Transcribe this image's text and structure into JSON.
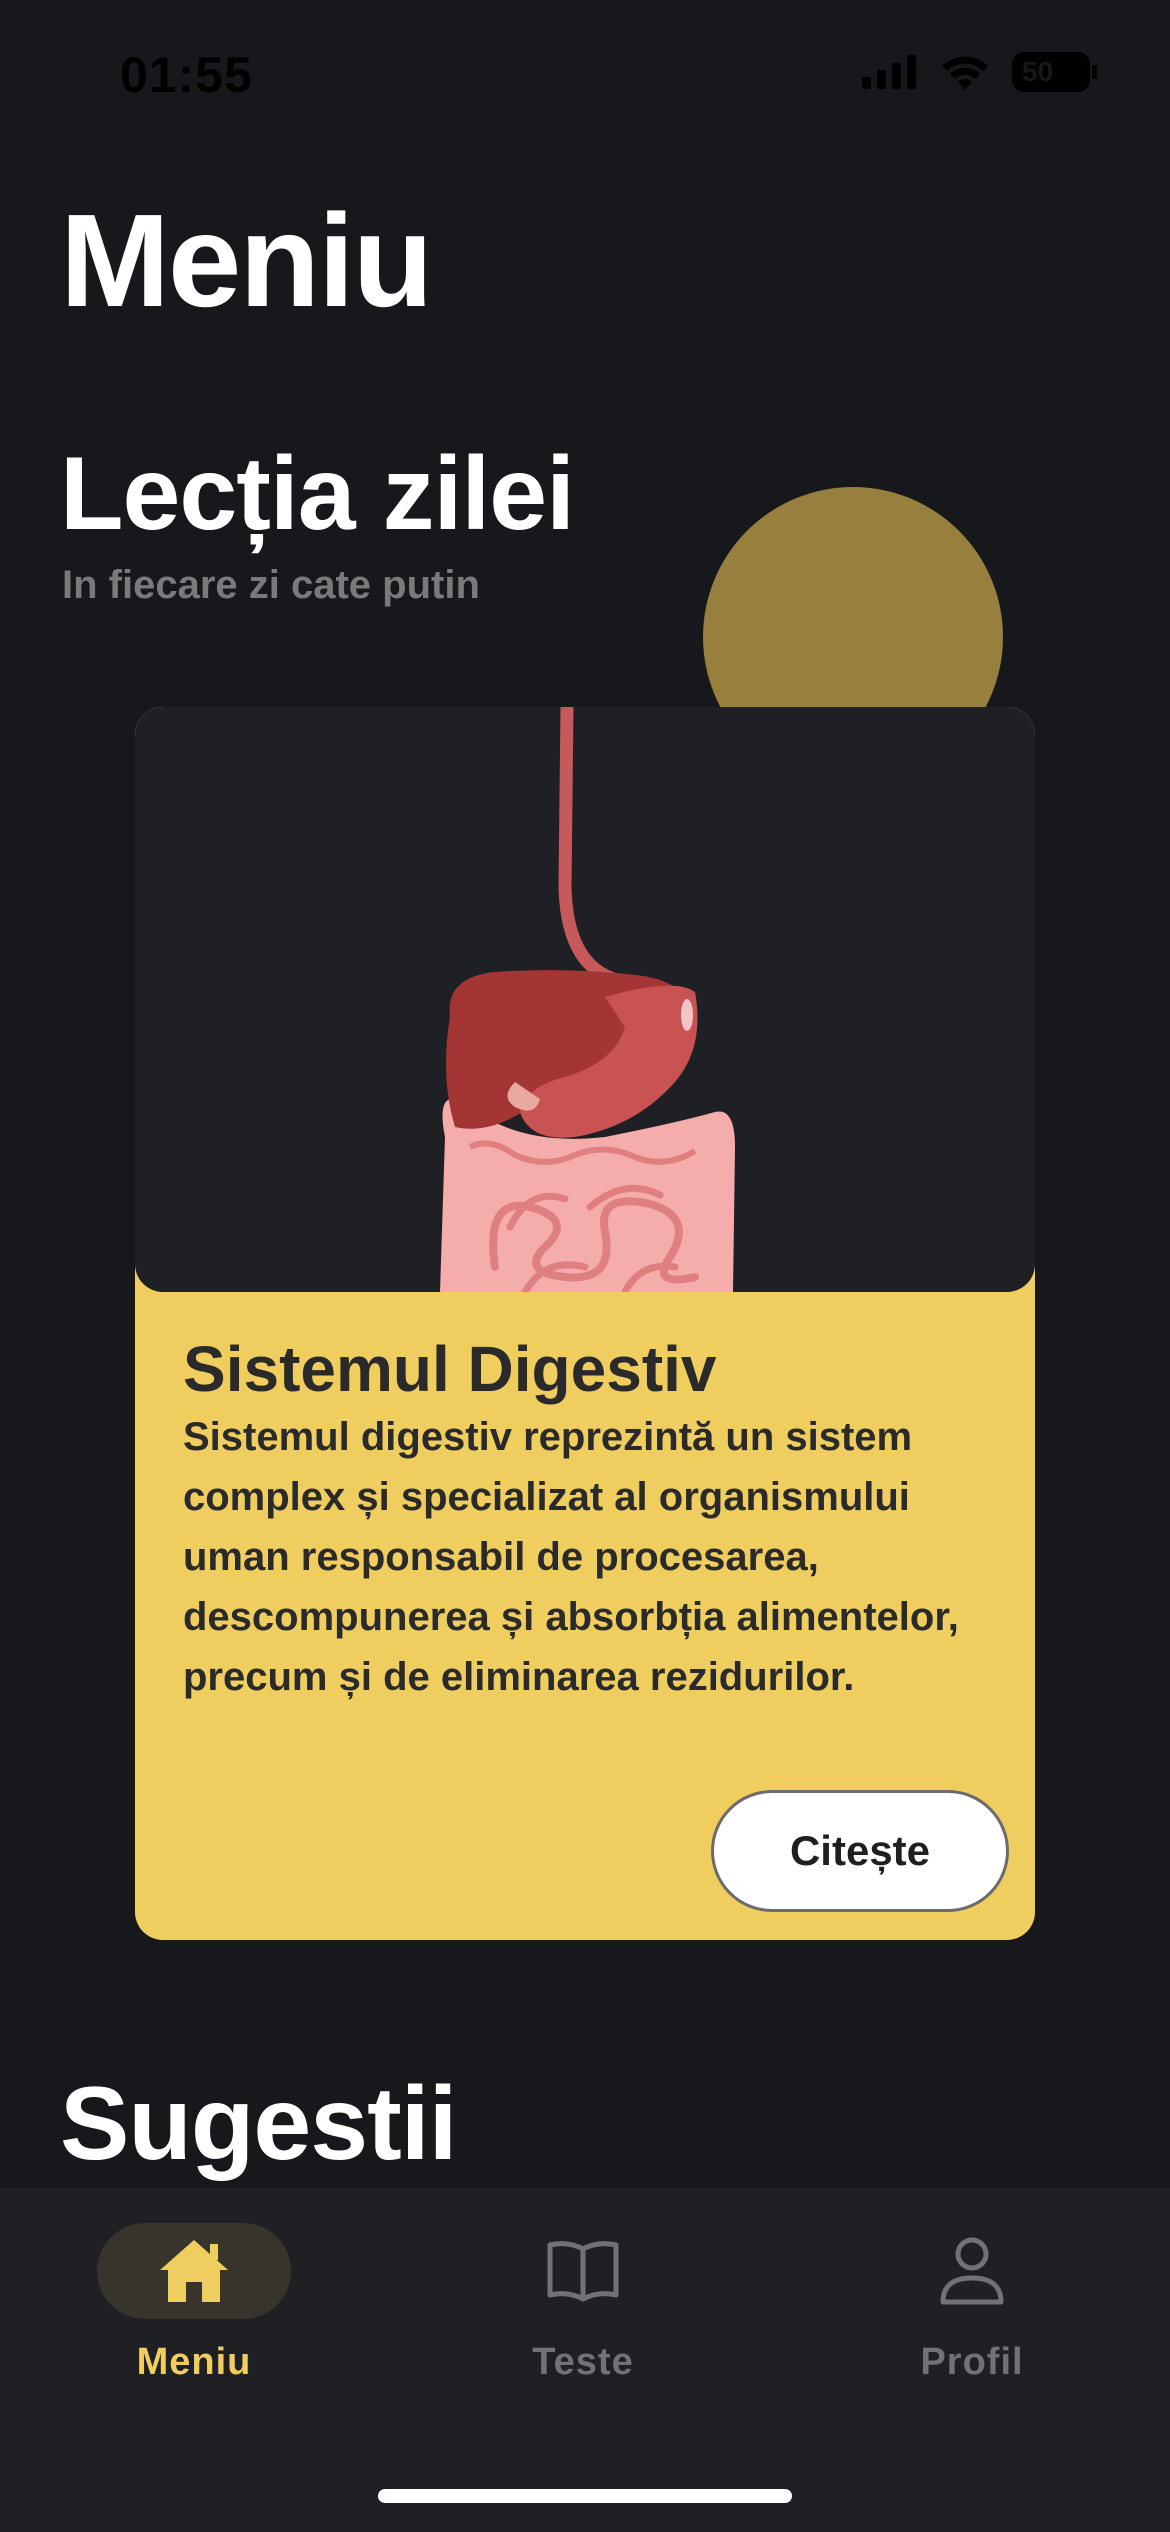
{
  "status_bar": {
    "time": "01:55",
    "battery_level": "50",
    "icons": [
      "cellular-signal-icon",
      "wifi-icon",
      "battery-icon"
    ]
  },
  "page": {
    "title": "Meniu"
  },
  "lesson_section": {
    "title": "Lecția zilei",
    "subtitle": "In fiecare zi cate putin"
  },
  "lesson_card": {
    "image": "digestive-system-illustration",
    "title": "Sistemul Digestiv",
    "description": "Sistemul digestiv reprezintă un sistem complex și specializat al organismului uman responsabil de procesarea, descompunerea și absorbția alimentelor, precum și de eliminarea rezidurilor.",
    "button_label": "Citește"
  },
  "suggestions_section": {
    "title": "Sugestii"
  },
  "tab_bar": {
    "tabs": [
      {
        "label": "Meniu",
        "icon": "home-icon",
        "active": true
      },
      {
        "label": "Teste",
        "icon": "book-icon",
        "active": false
      },
      {
        "label": "Profil",
        "icon": "person-icon",
        "active": false
      }
    ]
  },
  "colors": {
    "background": "#17181c",
    "accent_yellow": "#efcd5e",
    "deco_circle": "#977f3e",
    "card_media_bg": "#1f2024",
    "tab_bar_bg": "#1f2023",
    "inactive_tab": "#727276"
  }
}
